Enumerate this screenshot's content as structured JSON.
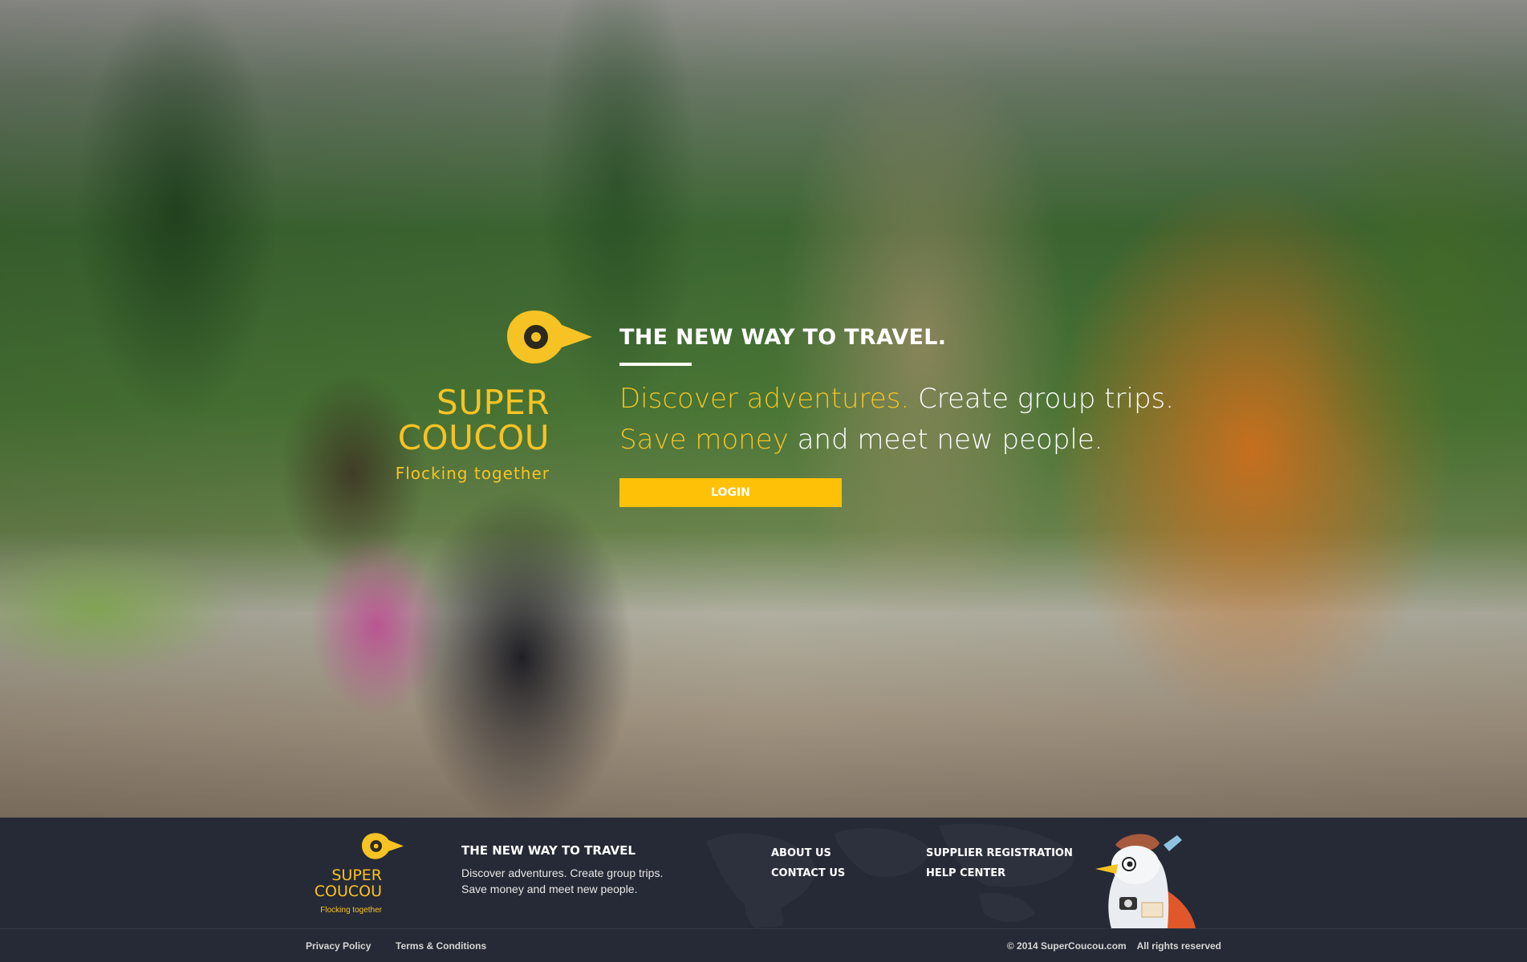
{
  "brand": {
    "line1": "SUPER",
    "line2": "COUCOU",
    "tagline": "Flocking together",
    "accent": "#f7c324",
    "logo_icon": "location-pin-eye-icon"
  },
  "hero": {
    "heading": "THE NEW WAY TO TRAVEL.",
    "line1_highlight": "Discover adventures.",
    "line1_rest": " Create group trips.",
    "line2_highlight": "Save money",
    "line2_rest": " and meet new people.",
    "login_label": "LOGIN",
    "button_color": "#ffc107"
  },
  "footer": {
    "about_title": "THE NEW WAY TO TRAVEL",
    "about_line1": "Discover adventures. Create group trips.",
    "about_line2": "Save money and meet new people.",
    "links_col1": [
      "ABOUT US",
      "CONTACT US"
    ],
    "links_col2": [
      "SUPPLIER REGISTRATION",
      "HELP CENTER"
    ],
    "mascot_icon": "bird-mascot-icon",
    "privacy": "Privacy Policy",
    "terms": "Terms & Conditions",
    "copyright": "© 2014 SuperCoucou.com    All rights reserved",
    "background": "#262a36"
  }
}
